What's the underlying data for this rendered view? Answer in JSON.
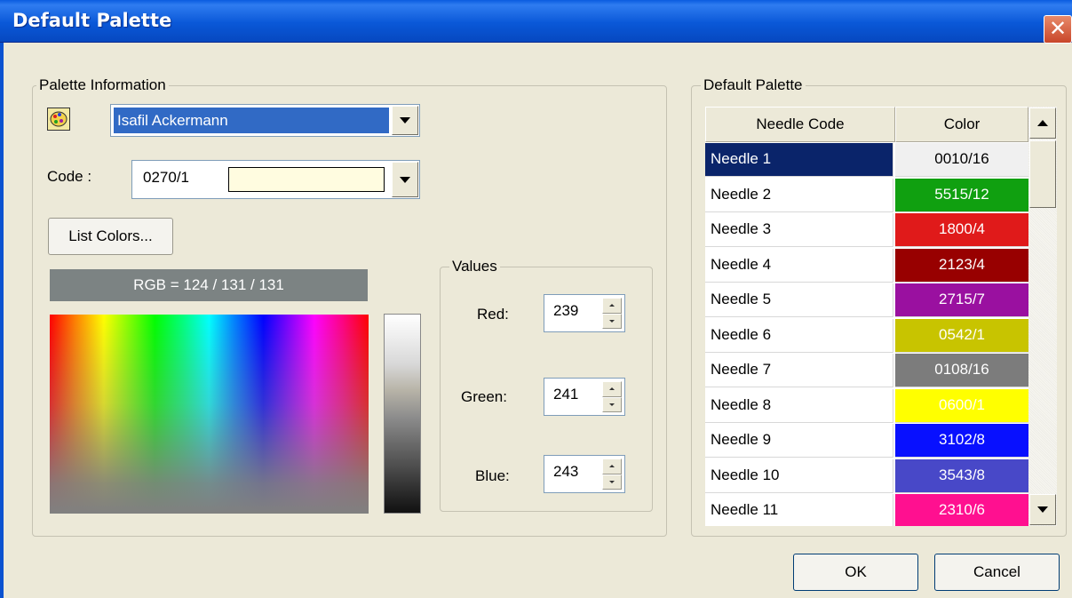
{
  "window": {
    "title": "Default Palette"
  },
  "palette_info": {
    "group_label": "Palette Information",
    "palette_name": "Isafil Ackermann",
    "code_label": "Code :",
    "code_value": "0270/1",
    "code_swatch_color": "#fffce0",
    "list_colors_label": "List Colors...",
    "rgb_text": "RGB = 124 / 131 / 131"
  },
  "values": {
    "group_label": "Values",
    "red_label": "Red:",
    "red_value": "239",
    "green_label": "Green:",
    "green_value": "241",
    "blue_label": "Blue:",
    "blue_value": "243"
  },
  "default_palette": {
    "group_label": "Default Palette",
    "columns": [
      "Needle Code",
      "Color"
    ],
    "rows": [
      {
        "needle": "Needle 1",
        "code": "0010/16",
        "bg": "#f0f0f0",
        "fg": "#000000",
        "selected": true
      },
      {
        "needle": "Needle 2",
        "code": "5515/12",
        "bg": "#10a010",
        "fg": "#ffffff",
        "selected": false
      },
      {
        "needle": "Needle 3",
        "code": "1800/4",
        "bg": "#e01a1a",
        "fg": "#ffffff",
        "selected": false
      },
      {
        "needle": "Needle 4",
        "code": "2123/4",
        "bg": "#980000",
        "fg": "#ffffff",
        "selected": false
      },
      {
        "needle": "Needle 5",
        "code": "2715/7",
        "bg": "#9a10a0",
        "fg": "#ffffff",
        "selected": false
      },
      {
        "needle": "Needle 6",
        "code": "0542/1",
        "bg": "#c8c400",
        "fg": "#ffffff",
        "selected": false
      },
      {
        "needle": "Needle 7",
        "code": "0108/16",
        "bg": "#7c7c7c",
        "fg": "#ffffff",
        "selected": false
      },
      {
        "needle": "Needle 8",
        "code": "0600/1",
        "bg": "#ffff00",
        "fg": "#ffffff",
        "selected": false
      },
      {
        "needle": "Needle 9",
        "code": "3102/8",
        "bg": "#0810ff",
        "fg": "#ffffff",
        "selected": false
      },
      {
        "needle": "Needle 10",
        "code": "3543/8",
        "bg": "#4848c8",
        "fg": "#ffffff",
        "selected": false
      },
      {
        "needle": "Needle 11",
        "code": "2310/6",
        "bg": "#ff1090",
        "fg": "#ffffff",
        "selected": false
      }
    ]
  },
  "buttons": {
    "ok": "OK",
    "cancel": "Cancel"
  },
  "icons": {
    "palette": "palette-icon",
    "close": "close-icon"
  }
}
